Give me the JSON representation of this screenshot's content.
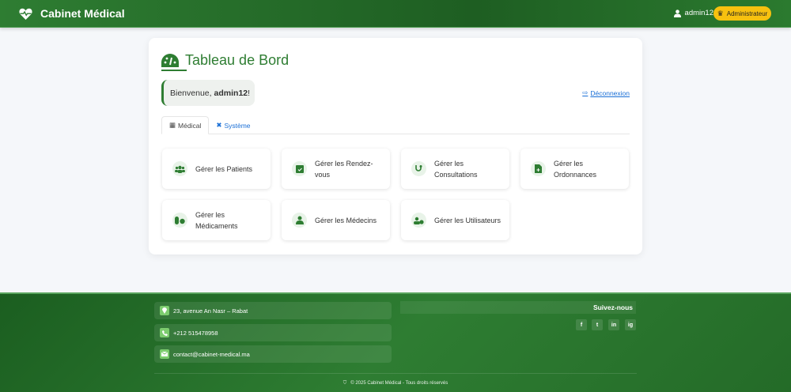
{
  "header": {
    "brand": "Cabinet Médical",
    "username": "admin12",
    "role": "Administrateur"
  },
  "dashboard": {
    "title": "Tableau de Bord",
    "welcome_prefix": "Bienvenue, ",
    "welcome_user": "admin12",
    "welcome_suffix": " !",
    "logout": "Déconnexion",
    "tabs": [
      {
        "label": "Médical"
      },
      {
        "label": "Système"
      }
    ],
    "tiles": [
      {
        "label": "Gérer les Patients",
        "icon": "users-icon"
      },
      {
        "label": "Gérer les Rendez-vous",
        "icon": "calendar-check-icon"
      },
      {
        "label": "Gérer les Consultations",
        "icon": "stethoscope-icon"
      },
      {
        "label": "Gérer les Ordonnances",
        "icon": "file-medical-icon"
      },
      {
        "label": "Gérer les Médicaments",
        "icon": "pills-icon"
      },
      {
        "label": "Gérer les Médecins",
        "icon": "user-doctor-icon"
      },
      {
        "label": "Gérer les Utilisateurs",
        "icon": "users-cog-icon"
      }
    ]
  },
  "footer": {
    "address": "23, avenue An Nasr – Rabat",
    "phone": "+212 515478958",
    "email": "contact@cabinet-medical.ma",
    "follow": "Suivez-nous",
    "social": [
      "f",
      "t",
      "in",
      "ig"
    ],
    "copyright": "© 2025 Cabinet Médical - Tous droits réservés"
  },
  "colors": {
    "primary": "#2e7d32",
    "badge": "#f7c10f",
    "link": "#1a6fd6"
  }
}
